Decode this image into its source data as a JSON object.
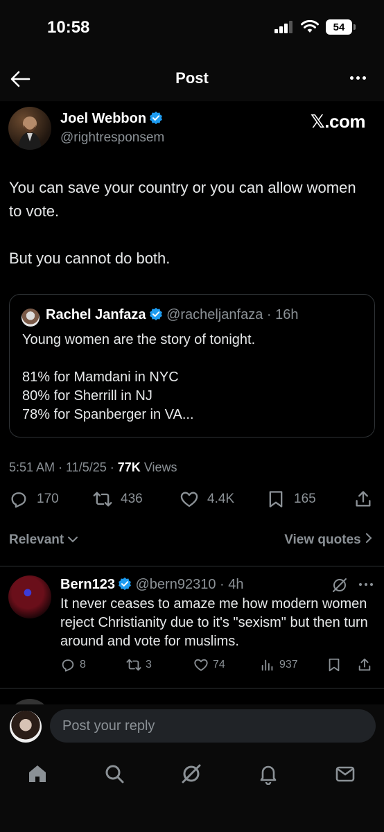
{
  "status": {
    "time": "10:58",
    "battery": "54"
  },
  "header": {
    "title": "Post"
  },
  "author": {
    "name": "Joel Webbon",
    "handle": "@rightresponsem",
    "brand": "𝕏.com"
  },
  "post": {
    "paragraphs": [
      "You can save your country or you can allow women to vote.",
      "But you cannot do both."
    ]
  },
  "quote": {
    "name": "Rachel Janfaza",
    "handle": "@racheljanfaza",
    "time": "16h",
    "lines": [
      "Young women are the story of tonight.",
      "81% for Mamdani in NYC",
      "80% for Sherrill in NJ",
      "78% for Spanberger in VA..."
    ]
  },
  "meta": {
    "time": "5:51 AM",
    "date": "11/5/25",
    "views_count": "77K",
    "views_label": "Views"
  },
  "actions": {
    "replies": "170",
    "reposts": "436",
    "likes": "4.4K",
    "bookmarks": "165"
  },
  "sort": {
    "left": "Relevant",
    "right": "View quotes"
  },
  "reply": {
    "name": "Bern123",
    "handle": "@bern92310",
    "time": "4h",
    "text": "It never ceases to amaze me how modern women reject Christianity due to it's \"sexism\" but then turn around and vote for muslims.",
    "replies": "8",
    "reposts": "3",
    "likes": "74",
    "views": "937"
  },
  "reply_box": {
    "placeholder": "Post your reply"
  },
  "colors": {
    "accent": "#1d9bf0",
    "muted": "#8b9196",
    "background": "#000000"
  }
}
